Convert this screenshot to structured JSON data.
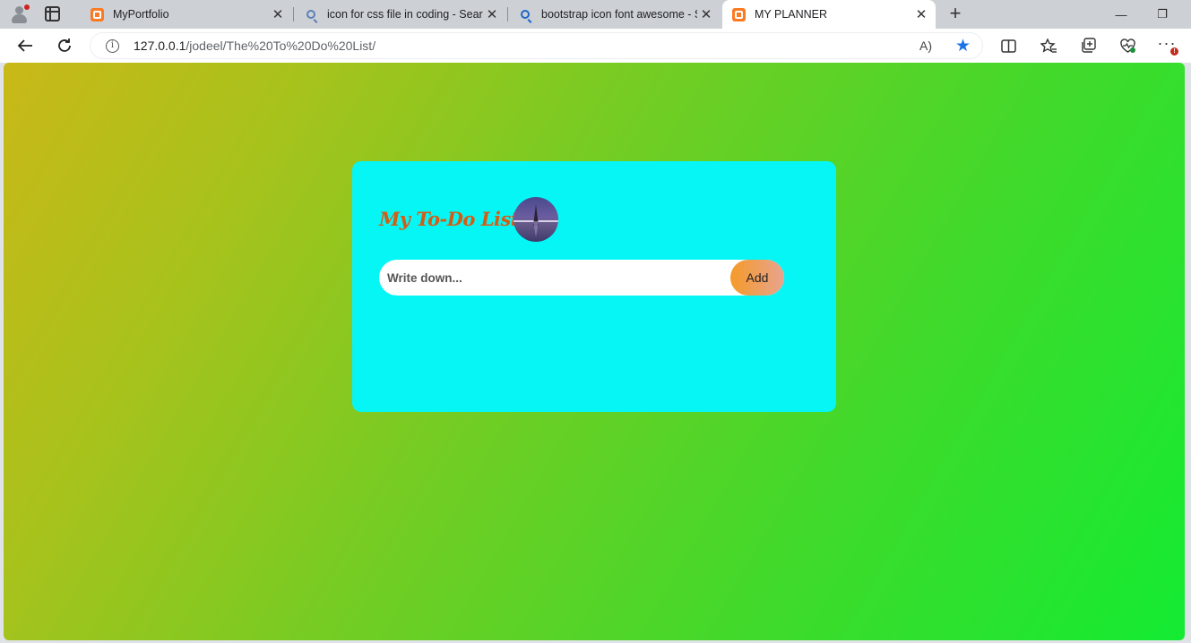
{
  "browser": {
    "tabs": [
      {
        "title": "MyPortfolio",
        "icon": "xampp-icon",
        "active": false
      },
      {
        "title": "icon for css file in coding - Search",
        "icon": "search-icon",
        "active": false
      },
      {
        "title": "bootstrap icon font awesome - S",
        "icon": "search-icon",
        "active": false
      },
      {
        "title": "MY PLANNER",
        "icon": "xampp-icon",
        "active": true
      }
    ],
    "close_glyph": "✕",
    "new_tab_glyph": "+",
    "window": {
      "minimize": "—",
      "restore": "❐"
    },
    "url": {
      "host": "127.0.0.1",
      "path": "/jodeel/The%20To%20Do%20List/"
    },
    "info_glyph": "i",
    "read_aloud_glyph": "A)",
    "favorite_glyph": "★",
    "badge": "!",
    "accent": "#1a73e8"
  },
  "app": {
    "title": "My To-Do List",
    "input": {
      "placeholder": "Write down...",
      "value": ""
    },
    "add_label": "Add",
    "colors": {
      "card": "#06f6f6",
      "title": "#d65c14",
      "gradient_start": "#c9b818",
      "gradient_end": "#14eb32"
    }
  }
}
